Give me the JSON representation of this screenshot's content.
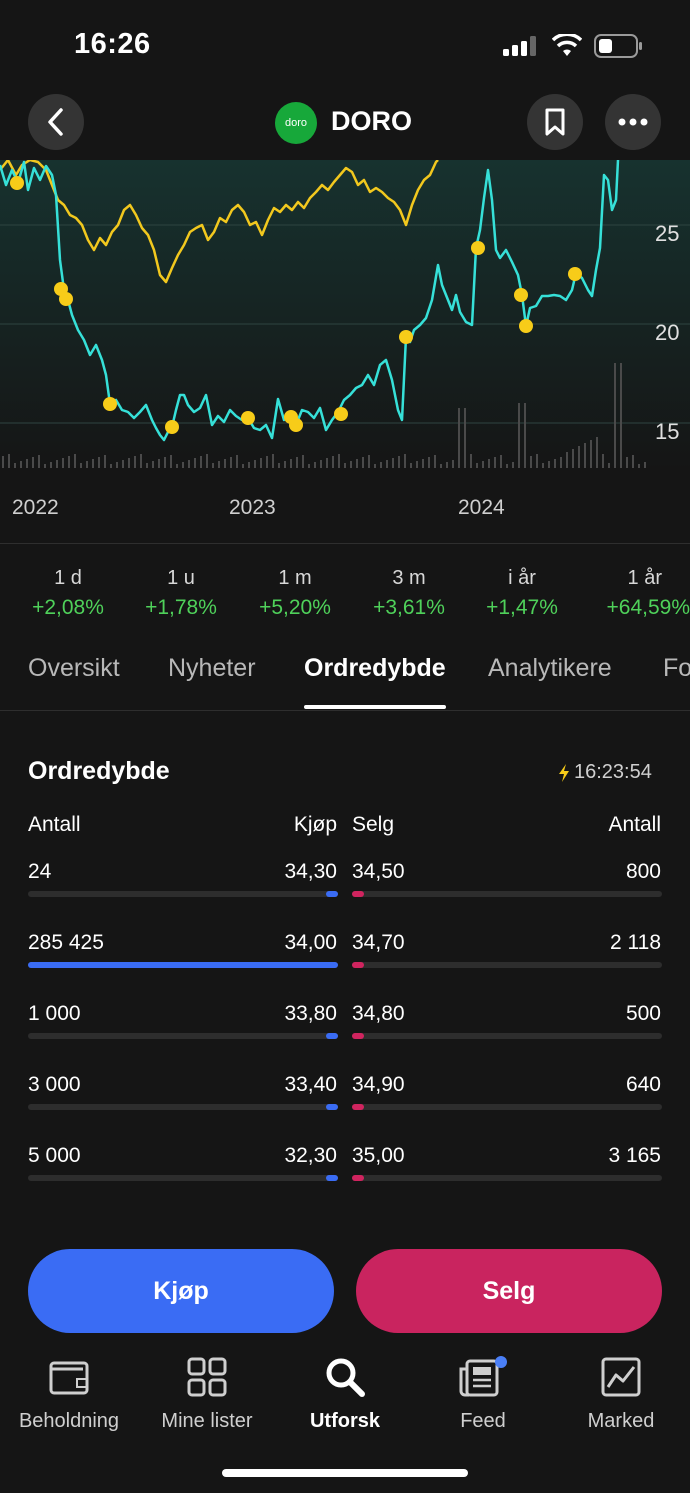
{
  "status": {
    "time": "16:26"
  },
  "header": {
    "title": "DORO",
    "logo_text": "doro"
  },
  "chart": {
    "y_ticks": [
      "25",
      "20",
      "15"
    ],
    "x_labels": [
      "2022",
      "2023",
      "2024"
    ]
  },
  "periods": [
    {
      "label": "1 d",
      "value": "+2,08%"
    },
    {
      "label": "1 u",
      "value": "+1,78%"
    },
    {
      "label": "1 m",
      "value": "+5,20%"
    },
    {
      "label": "3 m",
      "value": "+3,61%"
    },
    {
      "label": "i år",
      "value": "+1,47%"
    },
    {
      "label": "1 år",
      "value": "+64,59%"
    }
  ],
  "tabs": [
    {
      "label": "Oversikt"
    },
    {
      "label": "Nyheter"
    },
    {
      "label": "Ordredybde"
    },
    {
      "label": "Analytikere"
    },
    {
      "label": "Fo"
    }
  ],
  "order_depth": {
    "title": "Ordredybde",
    "timestamp": "16:23:54",
    "headers": {
      "qty_left": "Antall",
      "buy": "Kjøp",
      "sell": "Selg",
      "qty_right": "Antall"
    },
    "rows": [
      {
        "buy_qty": "24",
        "buy_price": "34,30",
        "sell_price": "34,50",
        "sell_qty": "800",
        "buy_fill": 0.01,
        "sell_fill": 0.01
      },
      {
        "buy_qty": "285 425",
        "buy_price": "34,00",
        "sell_price": "34,70",
        "sell_qty": "2 118",
        "buy_fill": 1.0,
        "sell_fill": 0.01
      },
      {
        "buy_qty": "1 000",
        "buy_price": "33,80",
        "sell_price": "34,80",
        "sell_qty": "500",
        "buy_fill": 0.01,
        "sell_fill": 0.01
      },
      {
        "buy_qty": "3 000",
        "buy_price": "33,40",
        "sell_price": "34,90",
        "sell_qty": "640",
        "buy_fill": 0.01,
        "sell_fill": 0.01
      },
      {
        "buy_qty": "5 000",
        "buy_price": "32,30",
        "sell_price": "35,00",
        "sell_qty": "3 165",
        "buy_fill": 0.02,
        "sell_fill": 0.01
      }
    ]
  },
  "actions": {
    "buy": "Kjøp",
    "sell": "Selg"
  },
  "nav": [
    {
      "label": "Beholdning",
      "icon": "wallet-icon"
    },
    {
      "label": "Mine lister",
      "icon": "grid-icon"
    },
    {
      "label": "Utforsk",
      "icon": "search-icon"
    },
    {
      "label": "Feed",
      "icon": "newspaper-icon"
    },
    {
      "label": "Marked",
      "icon": "chart-icon"
    }
  ],
  "colors": {
    "buy": "#3a6cf4",
    "sell": "#c9245f",
    "positive": "#4fd15a",
    "line_main": "#36e0d8",
    "line_compare": "#f2c81e"
  }
}
